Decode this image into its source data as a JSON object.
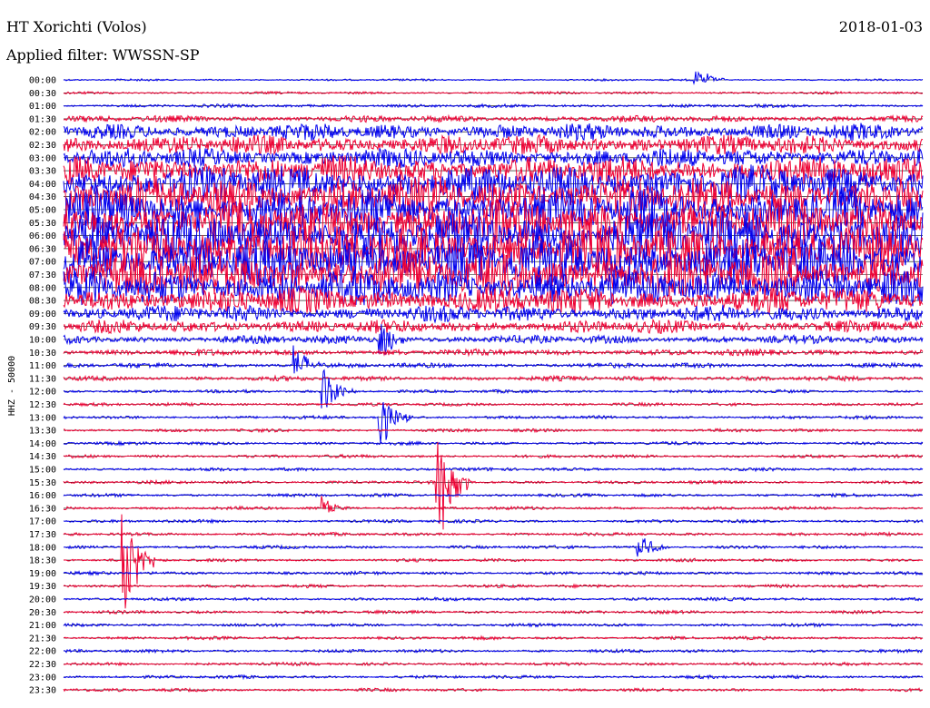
{
  "header": {
    "station": "HT Xorichti (Volos)",
    "date": "2018-01-03",
    "filter": "Applied filter: WWSSN-SP"
  },
  "chart_data": {
    "type": "line",
    "ylabel": "HHZ - 50000",
    "tick_labels": [
      "00:00",
      "00:30",
      "01:00",
      "01:30",
      "02:00",
      "02:30",
      "03:00",
      "03:30",
      "04:00",
      "04:30",
      "05:00",
      "05:30",
      "06:00",
      "06:30",
      "07:00",
      "07:30",
      "08:00",
      "08:30",
      "09:00",
      "09:30",
      "10:00",
      "10:30",
      "11:00",
      "11:30",
      "12:00",
      "12:30",
      "13:00",
      "13:30",
      "14:00",
      "14:30",
      "15:00",
      "15:30",
      "16:00",
      "16:30",
      "17:00",
      "17:30",
      "18:00",
      "18:30",
      "19:00",
      "19:30",
      "20:00",
      "20:30",
      "21:00",
      "21:30",
      "22:00",
      "22:30",
      "23:00",
      "23:30"
    ],
    "trace_colors": [
      "#0000ee",
      "#ee0033"
    ],
    "baseline_color": "#000000",
    "noise_amplitude": [
      1.2,
      1.5,
      2,
      4,
      10,
      12,
      12,
      18,
      22,
      24,
      26,
      28,
      30,
      30,
      30,
      28,
      22,
      16,
      10,
      8,
      5,
      4,
      3,
      3,
      2,
      2,
      2,
      2,
      2,
      2,
      2,
      2,
      2,
      2,
      2,
      2,
      2,
      2,
      2,
      2,
      2,
      2,
      2,
      2,
      2,
      2,
      2,
      2
    ],
    "events": [
      {
        "row": 0,
        "minute": 22,
        "amp": 22,
        "down": 6
      },
      {
        "row": 20,
        "minute": 11,
        "amp": 25,
        "down": 30
      },
      {
        "row": 22,
        "minute": 8,
        "amp": 28,
        "down": 12
      },
      {
        "row": 24,
        "minute": 9,
        "amp": 30,
        "down": 30
      },
      {
        "row": 26,
        "minute": 11,
        "amp": 30,
        "down": 44
      },
      {
        "row": 31,
        "minute": 13,
        "amp": 52,
        "down": 96
      },
      {
        "row": 33,
        "minute": 9,
        "amp": 14,
        "down": 12
      },
      {
        "row": 36,
        "minute": 20,
        "amp": 20,
        "down": 20
      },
      {
        "row": 37,
        "minute": 2,
        "amp": 58,
        "down": 100
      }
    ],
    "lang": "en"
  }
}
